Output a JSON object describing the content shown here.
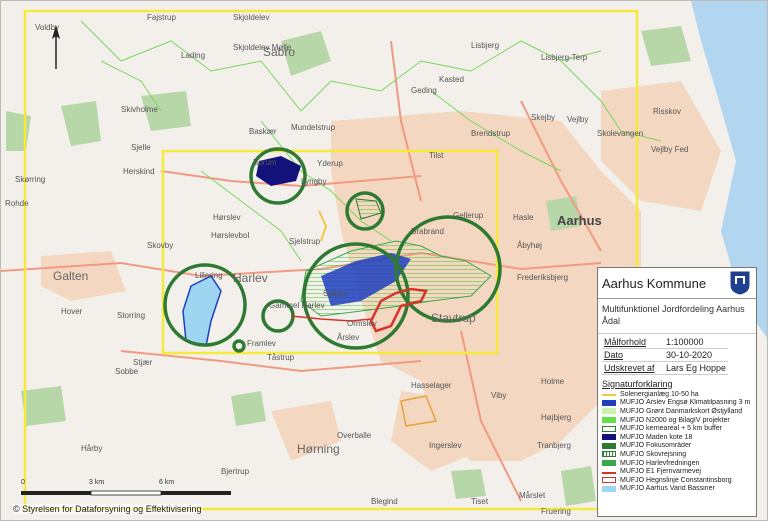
{
  "map": {
    "places": [
      {
        "name": "Voldby",
        "cls": "place"
      },
      {
        "name": "Fajstrup",
        "cls": "place"
      },
      {
        "name": "Skjoldelev",
        "cls": "place"
      },
      {
        "name": "Sabro",
        "cls": "place mid"
      },
      {
        "name": "Lading",
        "cls": "place"
      },
      {
        "name": "Skjoldelev Mølle",
        "cls": "place"
      },
      {
        "name": "Mundelstrup",
        "cls": "place"
      },
      {
        "name": "Lisbjerg",
        "cls": "place"
      },
      {
        "name": "Lisbjerg-Terp",
        "cls": "place"
      },
      {
        "name": "Kasted",
        "cls": "place"
      },
      {
        "name": "Geding",
        "cls": "place"
      },
      {
        "name": "Skivholme",
        "cls": "place"
      },
      {
        "name": "Baskær",
        "cls": "place"
      },
      {
        "name": "Brendstrup",
        "cls": "place"
      },
      {
        "name": "Skejby",
        "cls": "place"
      },
      {
        "name": "Vejlby",
        "cls": "place"
      },
      {
        "name": "Risskov",
        "cls": "place"
      },
      {
        "name": "Skolevangen",
        "cls": "place"
      },
      {
        "name": "Vejlby Fed",
        "cls": "place"
      },
      {
        "name": "Sjelle",
        "cls": "place"
      },
      {
        "name": "Herskind",
        "cls": "place"
      },
      {
        "name": "Borum",
        "cls": "place"
      },
      {
        "name": "Yderup",
        "cls": "place"
      },
      {
        "name": "Tilst",
        "cls": "place"
      },
      {
        "name": "Skørring",
        "cls": "place"
      },
      {
        "name": "Rohde",
        "cls": "place"
      },
      {
        "name": "Lyngby",
        "cls": "place"
      },
      {
        "name": "Gellerup",
        "cls": "place"
      },
      {
        "name": "Hasle",
        "cls": "place"
      },
      {
        "name": "Aarhus",
        "cls": "place big"
      },
      {
        "name": "Hørslev",
        "cls": "place"
      },
      {
        "name": "Hørslevbol",
        "cls": "place"
      },
      {
        "name": "Sjelstrup",
        "cls": "place"
      },
      {
        "name": "Brabrand",
        "cls": "place"
      },
      {
        "name": "Åbyhøj",
        "cls": "place"
      },
      {
        "name": "Galten",
        "cls": "place mid"
      },
      {
        "name": "Skovby",
        "cls": "place"
      },
      {
        "name": "Harlev",
        "cls": "place mid"
      },
      {
        "name": "Frederiksbjerg",
        "cls": "place"
      },
      {
        "name": "Lillering",
        "cls": "place"
      },
      {
        "name": "Hover",
        "cls": "place"
      },
      {
        "name": "Storring",
        "cls": "place"
      },
      {
        "name": "Gammel Harlev",
        "cls": "place"
      },
      {
        "name": "Skibby",
        "cls": "place"
      },
      {
        "name": "Ormslev",
        "cls": "place"
      },
      {
        "name": "Stavtrup",
        "cls": "place mid"
      },
      {
        "name": "Stjær",
        "cls": "place"
      },
      {
        "name": "Framlev",
        "cls": "place"
      },
      {
        "name": "Tåstrup",
        "cls": "place"
      },
      {
        "name": "Sobbe",
        "cls": "place"
      },
      {
        "name": "Årslev",
        "cls": "place"
      },
      {
        "name": "Hasselager",
        "cls": "place"
      },
      {
        "name": "Viby",
        "cls": "place"
      },
      {
        "name": "Holme",
        "cls": "place"
      },
      {
        "name": "Overballe",
        "cls": "place"
      },
      {
        "name": "Højbjerg",
        "cls": "place"
      },
      {
        "name": "Tranbjerg",
        "cls": "place"
      },
      {
        "name": "Hørning",
        "cls": "place mid"
      },
      {
        "name": "Ingerslev",
        "cls": "place"
      },
      {
        "name": "Hårby",
        "cls": "place"
      },
      {
        "name": "Bjertrup",
        "cls": "place"
      },
      {
        "name": "Blegind",
        "cls": "place"
      },
      {
        "name": "Mårslet",
        "cls": "place"
      },
      {
        "name": "Fruering",
        "cls": "place"
      },
      {
        "name": "Tiset",
        "cls": "place"
      }
    ],
    "scale_labels": [
      "0",
      "3 km",
      "6 km"
    ],
    "copyright": "© Styrelsen for Dataforsyning og Effektivisering"
  },
  "legend": {
    "title": "Aarhus Kommune",
    "project": "Multifunktionel Jordfordeling Aarhus Ådal",
    "info": [
      {
        "key": "Målforhold",
        "value": "1:100000"
      },
      {
        "key": "Dato",
        "value": "30-10-2020"
      },
      {
        "key": "Udskrevet af",
        "value": "Lars Eg Hoppe"
      }
    ],
    "signatur_title": "Signaturforklaring",
    "items": [
      {
        "label": "Solenergianlæg 10-50 ha",
        "color": "#f2c744",
        "style": "line"
      },
      {
        "label": "MUFJO Årslev Engsø Klimatilpasning 3 m",
        "color": "#1f3fbf",
        "style": "fill"
      },
      {
        "label": "MUFJO Grønt Danmarkskort Østjylland",
        "color": "#c8f2b0",
        "style": "fill"
      },
      {
        "label": "MUFJO N2000 og BilagIV projekter",
        "color": "#66e04a",
        "style": "fill"
      },
      {
        "label": "MUFJO kerneareal + 5 km buffer",
        "color": "#ffffff",
        "style": "outline"
      },
      {
        "label": "MUFJO Maden kote 18",
        "color": "#12127a",
        "style": "fill"
      },
      {
        "label": "MUFJO Fokusområder",
        "color": "#2f7a32",
        "style": "fill"
      },
      {
        "label": "MUFJO Skovrejsning",
        "color": "#2f7a32",
        "style": "hatch"
      },
      {
        "label": "MUFJO Harlevfredningen",
        "color": "#3aa84a",
        "style": "fill"
      },
      {
        "label": "MUFJO E1 Fjernvarmevej",
        "color": "#d6332a",
        "style": "line"
      },
      {
        "label": "MUFJO Hegnslinje Constantinsborg",
        "color": "#d6332a",
        "style": "outline"
      },
      {
        "label": "MUFJO Aarhus Vand Bassiner",
        "color": "#9ed6f2",
        "style": "fill"
      }
    ]
  }
}
